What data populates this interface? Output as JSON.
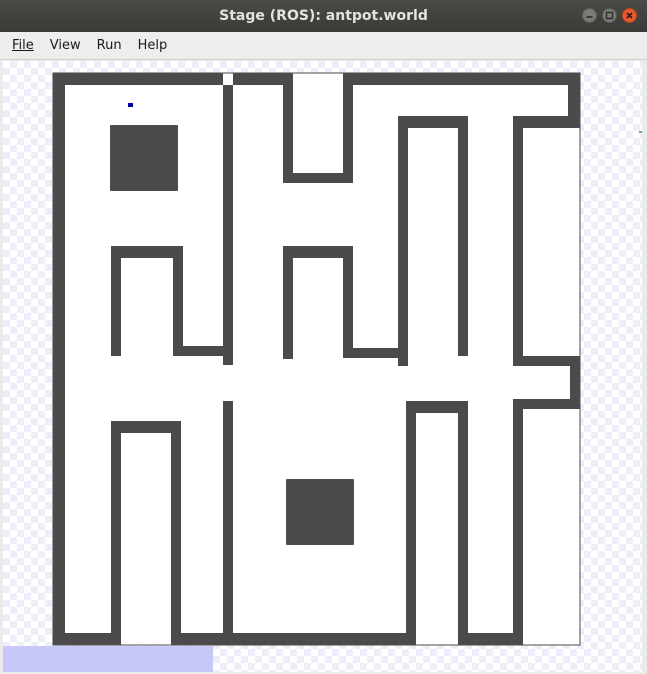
{
  "window": {
    "title": "Stage (ROS): antpot.world"
  },
  "menu": {
    "file": "File",
    "view": "View",
    "run": "Run",
    "help": "Help"
  },
  "icons": {
    "minimize": "minimize-icon",
    "maximize": "maximize-icon",
    "close": "close-icon"
  },
  "colors": {
    "wall": "#4b4b4b",
    "laser_region": "#c8c8f8",
    "robot": "#0000a0"
  }
}
